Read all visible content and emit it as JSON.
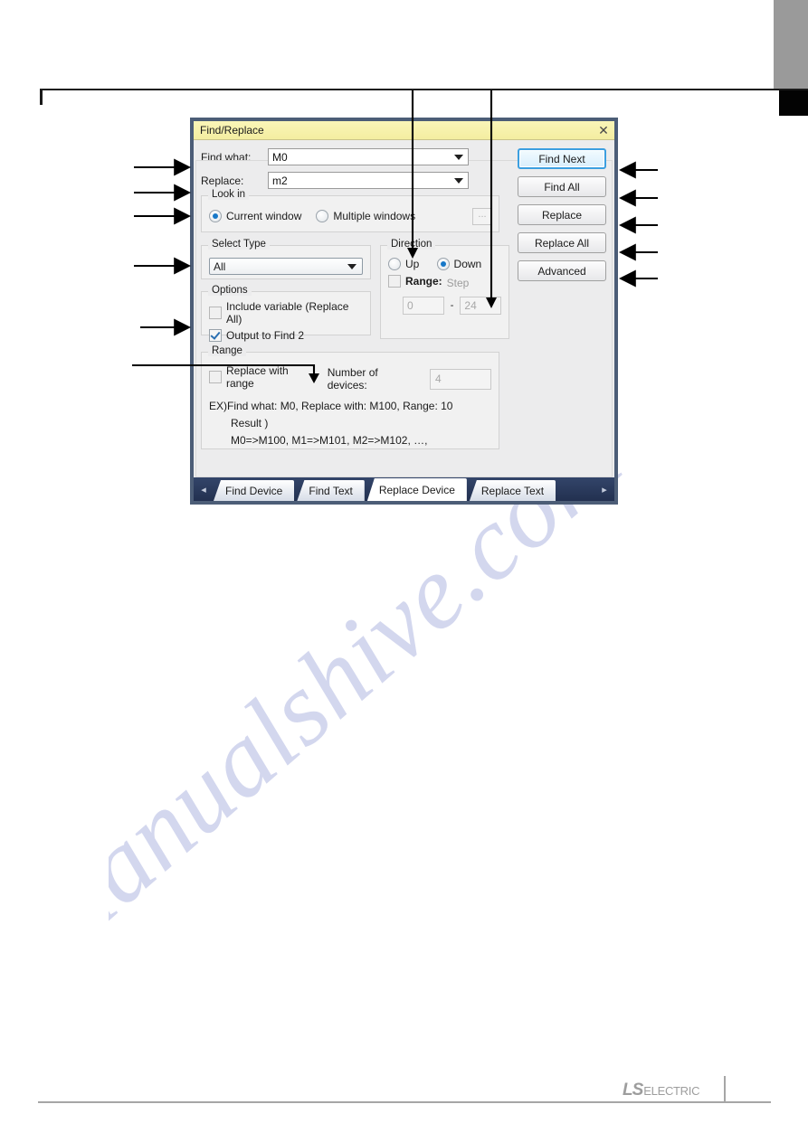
{
  "dialog": {
    "title": "Find/Replace",
    "close_icon": "close-icon",
    "find_what": {
      "label": "Find what:",
      "value": "M0"
    },
    "replace": {
      "label": "Replace:",
      "value": "m2"
    },
    "look_in": {
      "legend": "Look in",
      "options": [
        {
          "label": "Current window",
          "selected": true
        },
        {
          "label": "Multiple windows",
          "selected": false
        }
      ],
      "browse_label": "..."
    },
    "select_type": {
      "legend": "Select Type",
      "value": "All"
    },
    "options": {
      "legend": "Options",
      "items": [
        {
          "label": "Include variable (Replace All)",
          "checked": false
        },
        {
          "label": "Output to Find 2",
          "checked": true
        }
      ]
    },
    "direction": {
      "legend": "Direction",
      "radios": [
        {
          "label": "Up",
          "selected": false
        },
        {
          "label": "Down",
          "selected": true
        }
      ],
      "range_label": "Range:",
      "step_label": "Step",
      "range_checked": false,
      "from": "0",
      "to": "24",
      "dash": "-"
    },
    "range": {
      "legend": "Range",
      "replace_with_range_label": "Replace with range",
      "replace_with_range_checked": false,
      "number_of_devices_label": "Number of devices:",
      "number_of_devices_value": "4",
      "example_line_1": "EX)Find what: M0, Replace with: M100, Range: 10",
      "example_line_2": "Result )",
      "example_line_3": "M0=>M100, M1=>M101, M2=>M102, …,"
    },
    "buttons": [
      {
        "label": "Find Next",
        "focused": true
      },
      {
        "label": "Find All",
        "focused": false
      },
      {
        "label": "Replace",
        "focused": false
      },
      {
        "label": "Replace All",
        "focused": false
      },
      {
        "label": "Advanced",
        "focused": false
      }
    ],
    "tabs": {
      "prev_icon": "chevron-left-icon",
      "next_icon": "chevron-right-icon",
      "items": [
        {
          "label": "Find Device",
          "active": false
        },
        {
          "label": "Find Text",
          "active": false
        },
        {
          "label": "Replace Device",
          "active": true
        },
        {
          "label": "Replace Text",
          "active": false
        }
      ]
    }
  },
  "page": {
    "watermark": "manualshive.com",
    "footer_logo_ls": "LS",
    "footer_logo_electric": "ELECTRIC"
  }
}
